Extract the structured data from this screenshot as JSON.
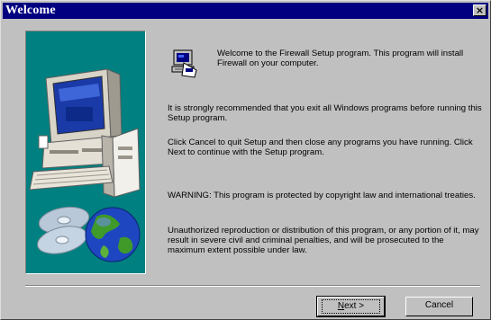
{
  "window": {
    "title": "Welcome",
    "close_label": "×"
  },
  "content": {
    "welcome_text": "Welcome to the Firewall Setup program.  This program will install Firewall on your computer.",
    "recommend_text": "It is strongly recommended that you exit all Windows programs before running this Setup program.",
    "cancel_next_text": "Click Cancel to quit Setup and then close any programs you have running. Click Next to continue with the Setup program.",
    "warning_text": "WARNING: This program is protected by copyright law and international treaties.",
    "unauthorized_text": "Unauthorized reproduction or distribution of this program, or any portion of it, may result in severe civil and criminal penalties, and will be prosecuted to the maximum extent possible under law."
  },
  "buttons": {
    "next_first": "N",
    "next_rest": "ext >",
    "cancel_label": "Cancel"
  },
  "colors": {
    "title_bar": "#000080",
    "panel_bg": "#008080",
    "dialog_bg": "#c0c0c0"
  },
  "icons": {
    "setup": "computer-setup-icon",
    "close": "close-icon"
  }
}
